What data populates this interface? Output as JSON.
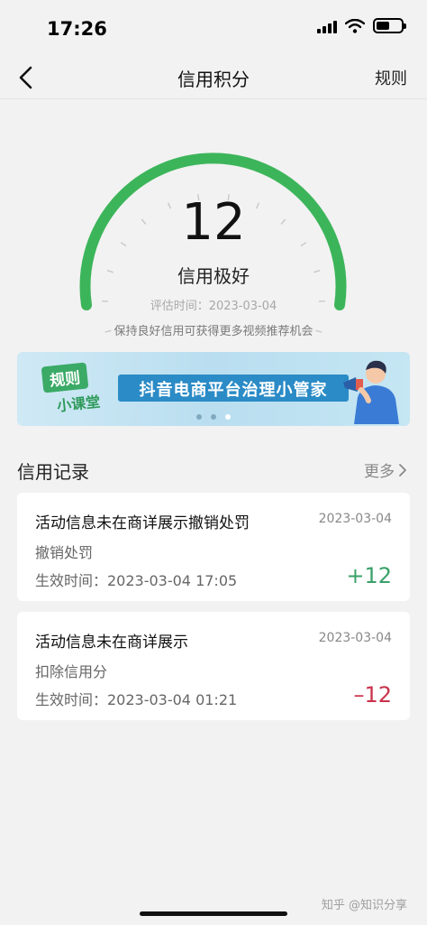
{
  "status_bar": {
    "time": "17:26"
  },
  "nav": {
    "title": "信用积分",
    "rule_link": "规则"
  },
  "credit": {
    "score": "12",
    "level": "信用极好",
    "evaluation": "评估时间：2023-03-04",
    "hint": "保持良好信用可获得更多视频推荐机会",
    "gauge_color": "#3cb55a"
  },
  "banner": {
    "badge_top": "规则",
    "badge_sub": "小课堂",
    "title": "抖音电商平台治理小管家",
    "active_dot": 2
  },
  "records": {
    "title": "信用记录",
    "more_label": "更多",
    "items": [
      {
        "title": "活动信息未在商详展示撤销处罚",
        "date": "2023-03-04",
        "type": "撤销处罚",
        "effective": "生效时间：2023-03-04 17:05",
        "delta": "+12"
      },
      {
        "title": "活动信息未在商详展示",
        "date": "2023-03-04",
        "type": "扣除信用分",
        "effective": "生效时间：2023-03-04 01:21",
        "delta": "–12"
      }
    ]
  },
  "watermark": "知乎 @知识分享"
}
